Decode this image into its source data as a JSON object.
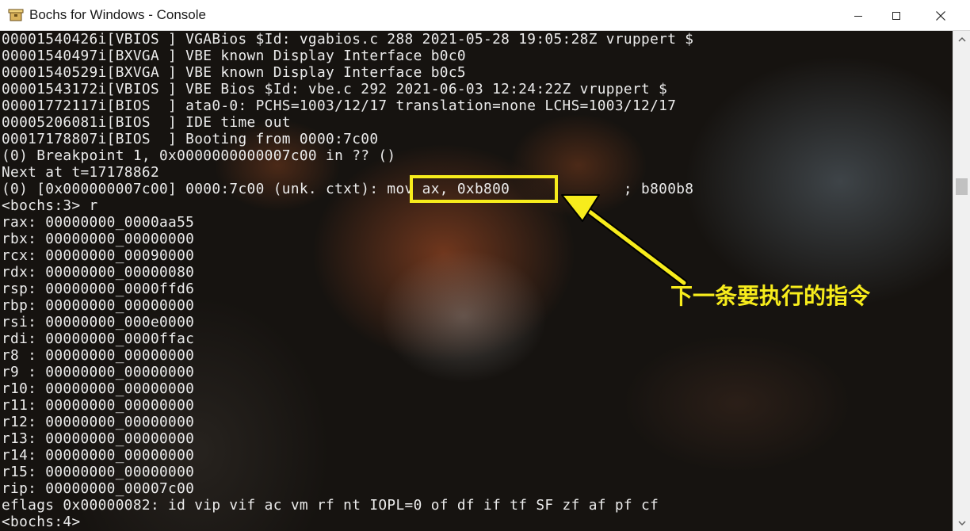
{
  "window": {
    "title": "Bochs for Windows - Console",
    "icon": "bochs-app-icon"
  },
  "controls": {
    "minimize_icon": "minimize-icon",
    "maximize_icon": "maximize-icon",
    "close_icon": "close-icon"
  },
  "console": {
    "lines": [
      "00001540426i[VBIOS ] VGABios $Id: vgabios.c 288 2021-05-28 19:05:28Z vruppert $",
      "00001540497i[BXVGA ] VBE known Display Interface b0c0",
      "00001540529i[BXVGA ] VBE known Display Interface b0c5",
      "00001543172i[VBIOS ] VBE Bios $Id: vbe.c 292 2021-06-03 12:24:22Z vruppert $",
      "00001772117i[BIOS  ] ata0-0: PCHS=1003/12/17 translation=none LCHS=1003/12/17",
      "00005206081i[BIOS  ] IDE time out",
      "00017178807i[BIOS  ] Booting from 0000:7c00",
      "(0) Breakpoint 1, 0x0000000000007c00 in ?? ()",
      "Next at t=17178862",
      "(0) [0x000000007c00] 0000:7c00 (unk. ctxt): mov ax, 0xb800             ; b800b8",
      "<bochs:3> r",
      "rax: 00000000_0000aa55",
      "rbx: 00000000_00000000",
      "rcx: 00000000_00090000",
      "rdx: 00000000_00000080",
      "rsp: 00000000_0000ffd6",
      "rbp: 00000000_00000000",
      "rsi: 00000000_000e0000",
      "rdi: 00000000_0000ffac",
      "r8 : 00000000_00000000",
      "r9 : 00000000_00000000",
      "r10: 00000000_00000000",
      "r11: 00000000_00000000",
      "r12: 00000000_00000000",
      "r13: 00000000_00000000",
      "r14: 00000000_00000000",
      "r15: 00000000_00000000",
      "rip: 00000000_00007c00",
      "eflags 0x00000082: id vip vif ac vm rf nt IOPL=0 of df if tf SF zf af pf cf",
      "<bochs:4>"
    ]
  },
  "annotation": {
    "highlight_color": "#f7ec1c",
    "label": "下一条要执行的指令"
  },
  "scrollbar": {
    "up_icon": "scroll-up-arrow-icon",
    "down_icon": "scroll-down-arrow-icon"
  }
}
